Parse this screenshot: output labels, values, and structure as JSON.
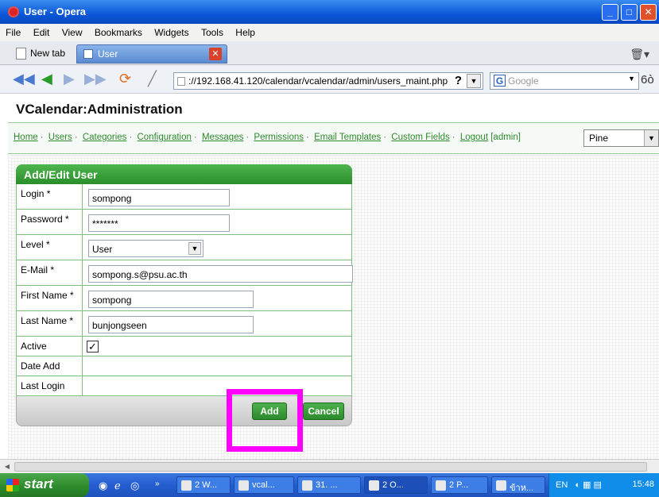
{
  "window": {
    "title": "User - Opera"
  },
  "menu": [
    "File",
    "Edit",
    "View",
    "Bookmarks",
    "Widgets",
    "Tools",
    "Help"
  ],
  "tabs": {
    "new_tab": "New tab",
    "active_tab": "User"
  },
  "nav": {
    "url": "://192.168.41.120/calendar/vcalendar/admin/users_maint.php",
    "search_placeholder": "Google"
  },
  "page": {
    "app_title": "VCalendar:Administration",
    "links": [
      "Home",
      "Users",
      "Categories",
      "Configuration",
      "Messages",
      "Permissions",
      "Email Templates",
      "Custom Fields",
      "Logout"
    ],
    "logged_in_user": "[admin]",
    "style_select": "Pine"
  },
  "form": {
    "header": "Add/Edit User",
    "fields": {
      "login": {
        "label": "Login *",
        "value": "sompong"
      },
      "password": {
        "label": "Password *",
        "value": "*******"
      },
      "level": {
        "label": "Level *",
        "value": "User"
      },
      "email": {
        "label": "E-Mail *",
        "value": "sompong.s@psu.ac.th"
      },
      "first_name": {
        "label": "First Name *",
        "value": "sompong"
      },
      "last_name": {
        "label": "Last Name *",
        "value": "bunjongseen"
      },
      "active": {
        "label": "Active",
        "checked": true
      },
      "date_add": {
        "label": "Date Add"
      },
      "last_login": {
        "label": "Last Login"
      }
    },
    "buttons": {
      "add": "Add",
      "cancel": "Cancel"
    }
  },
  "taskbar": {
    "start": "start",
    "tasks": [
      "2 W...",
      "vcal...",
      "31. ...",
      "2 O...",
      "2 P...",
      "ข้าห..."
    ],
    "tray_lang": "EN",
    "clock": "15:48"
  },
  "colors": {
    "accent_green": "#2a8e2a",
    "link_green": "#2e8a2e",
    "highlight_magenta": "#ff00ff"
  }
}
